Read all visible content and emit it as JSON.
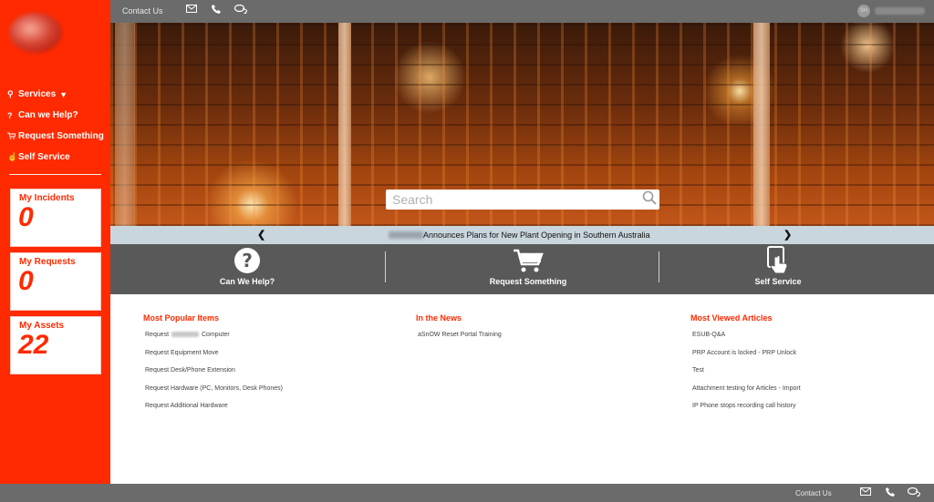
{
  "sidebar": {
    "nav": [
      {
        "icon": "wrench-icon",
        "glyph": "⚲",
        "label": "Services",
        "has_chevron": true
      },
      {
        "icon": "question-circle-icon",
        "glyph": "❓",
        "label": "Can we Help?"
      },
      {
        "icon": "cart-icon",
        "glyph": "🛒",
        "label": "Request Something"
      },
      {
        "icon": "hand-pointer-icon",
        "glyph": "☝",
        "label": "Self Service"
      }
    ],
    "cards": [
      {
        "title": "My Incidents",
        "value": "0"
      },
      {
        "title": "My Requests",
        "value": "0"
      },
      {
        "title": "My Assets",
        "value": "22"
      }
    ]
  },
  "topbar": {
    "contact_label": "Contact Us",
    "avatar_initials": "SH"
  },
  "search": {
    "placeholder": "Search"
  },
  "ticker": {
    "headline": "Announces Plans for New Plant Opening in Southern Australia",
    "prev": "❮",
    "next": "❯"
  },
  "actions": [
    {
      "icon": "question-circle-icon",
      "label": "Can We Help?"
    },
    {
      "icon": "cart-icon",
      "label": "Request Something"
    },
    {
      "icon": "touch-screen-icon",
      "label": "Self Service"
    }
  ],
  "sections": {
    "popular": {
      "title": "Most Popular Items",
      "items": [
        "Request",
        "Request Equipment Move",
        "Request Desk/Phone Extension",
        "Request Hardware (PC, Monitors, Desk Phones)",
        "Request Additional Hardware"
      ],
      "first_item_suffix": "Computer"
    },
    "news": {
      "title": "In the News",
      "items": [
        "aSnOW Reset Portal Training"
      ]
    },
    "viewed": {
      "title": "Most Viewed Articles",
      "items": [
        "ESUB-Q&A",
        "PRP Account is locked - PRP Unlock",
        "Test",
        "Attachment testing for Articles - Import",
        "IP Phone stops recording call history"
      ]
    }
  },
  "footer": {
    "contact_label": "Contact Us"
  },
  "colors": {
    "brand_red": "#ff2a00",
    "bar_gray": "#6b6b6b",
    "action_gray": "#595959",
    "ticker_blue": "#c9d6dd"
  }
}
